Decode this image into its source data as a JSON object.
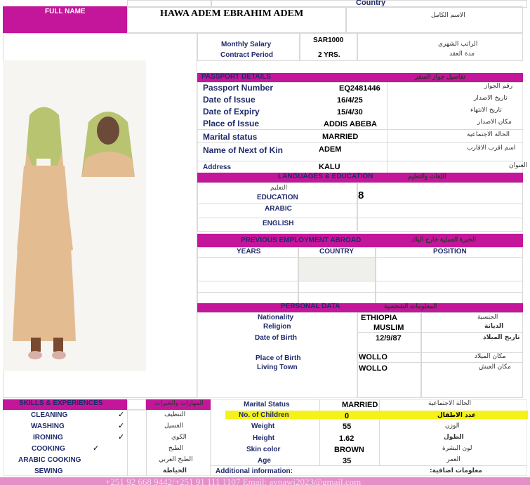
{
  "header": {
    "country_label": "Country",
    "full_name_label": "FULL NAME",
    "full_name": "HAWA ADEM EBRAHIM ADEM",
    "full_name_ar": "الاسم الكامل"
  },
  "employment": {
    "monthly_salary_label": "Monthly Salary",
    "monthly_salary": "SAR1000",
    "contract_period_label": "Contract Period",
    "contract_period": "2 YRS.",
    "salary_ar": "الراتب الشهري",
    "contract_ar": "مدة العقد"
  },
  "passport": {
    "section_title": "PASSPORT DETAILS",
    "section_title_ar": "تفاصيل جواز السفر",
    "number_label": "Passport Number",
    "number": "EQ2481446",
    "number_ar": "رقم الجواز",
    "issue_date_label": "Date of Issue",
    "issue_date": "16/4/25",
    "issue_date_ar": "تاريخ الاصدار",
    "expiry_label": "Date of Expiry",
    "expiry": "15/4/30",
    "expiry_ar": "تاريخ الانتهاء",
    "place_label": "Place of Issue",
    "place": "ADDIS ABEBA",
    "place_ar": "مكان الاصدار",
    "marital_label": "Marital status",
    "marital": "MARRIED",
    "marital_ar": "الحالة الاجتماعية",
    "kin_label": "Name of Next of Kin",
    "kin": "ADEM",
    "kin_ar": "اسم اقرب الاقارب",
    "address_label": "Address",
    "address": "KALU",
    "address_ar": "العنوان"
  },
  "languages": {
    "section_title": "LANGUAGES & EDUCATION",
    "section_title_ar": "اللغات والتعليم",
    "education_ar": "التعليم",
    "education_label": "EDUCATION",
    "education_value": "8",
    "arabic_label": "ARABIC",
    "english_label": "ENGLISH"
  },
  "previous_employment": {
    "section_title": "PREVIOUS EMPLOYMENT ABROAD",
    "section_title_ar": "الخبرة العملية خارج البلاد",
    "columns": [
      "YEARS",
      "COUNTRY",
      "POSITION"
    ]
  },
  "personal": {
    "section_title": "PERSONAL DATA",
    "section_title_ar": "المعلومات الشخصية",
    "nationality_label": "Nationality",
    "nationality": "ETHIOPIA",
    "nationality_ar": "الجنسية",
    "religion_label": "Religion",
    "religion": "MUSLIM",
    "religion_ar": "الديانة",
    "dob_label": "Date of Birth",
    "dob": "12/9/87",
    "dob_ar": "تاريخ الميلاد",
    "pob_label": "Place of Birth",
    "pob": "WOLLO",
    "pob_ar": "مكان الميلاد",
    "living_label": "Living Town",
    "living": "WOLLO",
    "living_ar": "مكان العيش"
  },
  "skills": {
    "section_title": "SKILLS & EXPERIENCES",
    "section_title_ar": "المهارات والخبرات",
    "items": [
      {
        "label": "CLEANING",
        "check": "✓",
        "ar": "التنظيف"
      },
      {
        "label": "WASHING",
        "check": "✓",
        "ar": "الغسيل"
      },
      {
        "label": "IRONING",
        "check": "✓",
        "ar": "الكوي"
      },
      {
        "label": "COOKING",
        "check": "✓",
        "ar": "الطبخ"
      },
      {
        "label": "ARABIC COOKING",
        "check": "",
        "ar": "الطبخ العربي"
      },
      {
        "label": "SEWING",
        "check": "",
        "ar": "الخياطة"
      }
    ]
  },
  "details": {
    "marital_label": "Marital Status",
    "marital": "MARRIED",
    "marital_ar": "الحالة الاجتماعية",
    "children_label": "No. of Children",
    "children": "0",
    "children_ar": "عدد الاطفال",
    "weight_label": "Weight",
    "weight": "55",
    "weight_ar": "الوزن",
    "height_label": "Height",
    "height": "1.62",
    "height_ar": "الطول",
    "skin_label": "Skin color",
    "skin": "BROWN",
    "skin_ar": "لون البشرة",
    "age_label": "Age",
    "age": "35",
    "age_ar": "العمر",
    "additional_label": "Additional information:",
    "additional_ar": "معلومات اضافية:"
  },
  "footer": {
    "contact": "+251 92 668 9442/+251 91 111 1107 Email: aynawi2023@gmail.com"
  },
  "colors": {
    "accent": "#c4169a",
    "highlight": "#f5f21a",
    "label_text": "#1f2a6b",
    "footer_bg": "#e58fc9"
  }
}
